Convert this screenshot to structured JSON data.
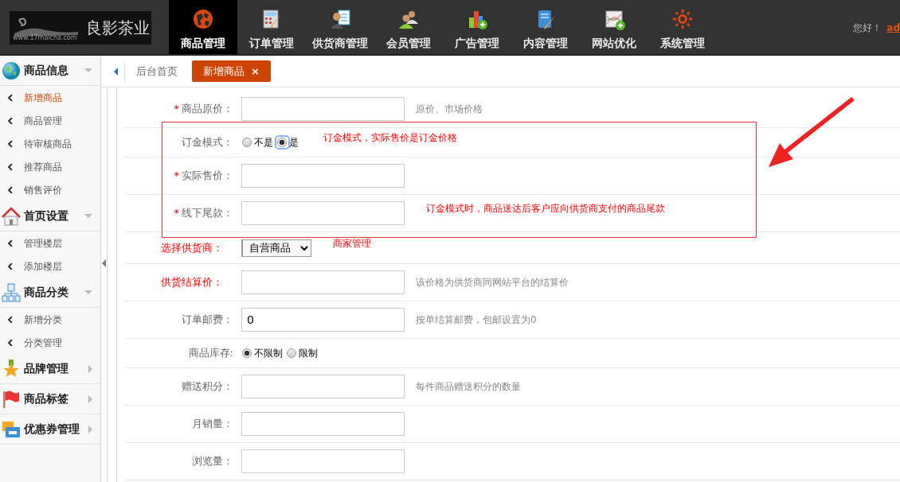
{
  "header": {
    "logo": {
      "site": "www.17maicha.com",
      "brand": "良影茶业"
    },
    "nav": [
      {
        "label": "商品管理",
        "selected": true
      },
      {
        "label": "订单管理",
        "selected": false
      },
      {
        "label": "供货商管理",
        "selected": false
      },
      {
        "label": "会员管理",
        "selected": false
      },
      {
        "label": "广告管理",
        "selected": false
      },
      {
        "label": "内容管理",
        "selected": false
      },
      {
        "label": "网站优化",
        "selected": false
      },
      {
        "label": "系统管理",
        "selected": false
      }
    ],
    "greeting": "您好！",
    "user": "ad"
  },
  "sidebar": {
    "groups": [
      {
        "title": "商品信息",
        "expanded": true,
        "items": [
          {
            "label": "新增商品",
            "selected": true
          },
          {
            "label": "商品管理",
            "selected": false
          },
          {
            "label": "待审核商品",
            "selected": false
          },
          {
            "label": "推荐商品",
            "selected": false
          },
          {
            "label": "销售评价",
            "selected": false
          }
        ]
      },
      {
        "title": "首页设置",
        "expanded": true,
        "items": [
          {
            "label": "管理楼层",
            "selected": false
          },
          {
            "label": "添加楼层",
            "selected": false
          }
        ]
      },
      {
        "title": "商品分类",
        "expanded": true,
        "items": [
          {
            "label": "新增分类",
            "selected": false
          },
          {
            "label": "分类管理",
            "selected": false
          }
        ]
      },
      {
        "title": "品牌管理",
        "expanded": false
      },
      {
        "title": "商品标签",
        "expanded": false
      },
      {
        "title": "优惠券管理",
        "expanded": false
      }
    ]
  },
  "tabs": [
    {
      "label": "后台首页",
      "selected": false
    },
    {
      "label": "新增商品",
      "selected": true,
      "close": "×"
    }
  ],
  "form": {
    "rows": [
      {
        "kind": "text",
        "label": "商品原价：",
        "required_mark": "*",
        "alert": false,
        "hint": "原价、市场价格",
        "hint_alert": false
      },
      {
        "kind": "radio",
        "label": "订金模式：",
        "alert": false,
        "options": [
          {
            "label": "不是",
            "selected": false,
            "focused": false
          },
          {
            "label": "是",
            "selected": true,
            "focused": true
          }
        ],
        "hint": "订金模式，实际售价是订金价格",
        "hint_alert": true
      },
      {
        "kind": "text",
        "label": "实际售价：",
        "required_mark": "*",
        "alert": false
      },
      {
        "kind": "text",
        "label": "线下尾款：",
        "required_mark": "*",
        "alert": false,
        "hint": "订金模式时，商品送达后客户应向供货商支付的商品尾款",
        "hint_alert": true
      },
      {
        "kind": "select",
        "label": "选择供货商：",
        "alert": true,
        "value": "自营商品",
        "hint": "商家管理",
        "hint_alert": true
      },
      {
        "kind": "text",
        "label": "供货结算价：",
        "alert": true,
        "hint": "该价格为供货商同网站平台的结算价",
        "hint_alert": false
      },
      {
        "kind": "text",
        "label": "订单邮费：",
        "alert": false,
        "value": "0",
        "hint": "按单结算邮费，包邮设置为0",
        "hint_alert": false
      },
      {
        "kind": "radio",
        "label": "商品库存:",
        "alert": false,
        "options": [
          {
            "label": "不限制",
            "selected": true,
            "focused": false
          },
          {
            "label": "限制",
            "selected": false,
            "focused": false
          }
        ]
      },
      {
        "kind": "text",
        "label": "赠送积分：",
        "alert": false,
        "hint": "每件商品赠送积分的数量",
        "hint_alert": false
      },
      {
        "kind": "text",
        "label": "月销量：",
        "alert": false
      },
      {
        "kind": "text",
        "label": "浏览量：",
        "alert": false
      }
    ]
  },
  "annotations": [
    {
      "kind": "box"
    },
    {
      "kind": "arrow"
    }
  ]
}
